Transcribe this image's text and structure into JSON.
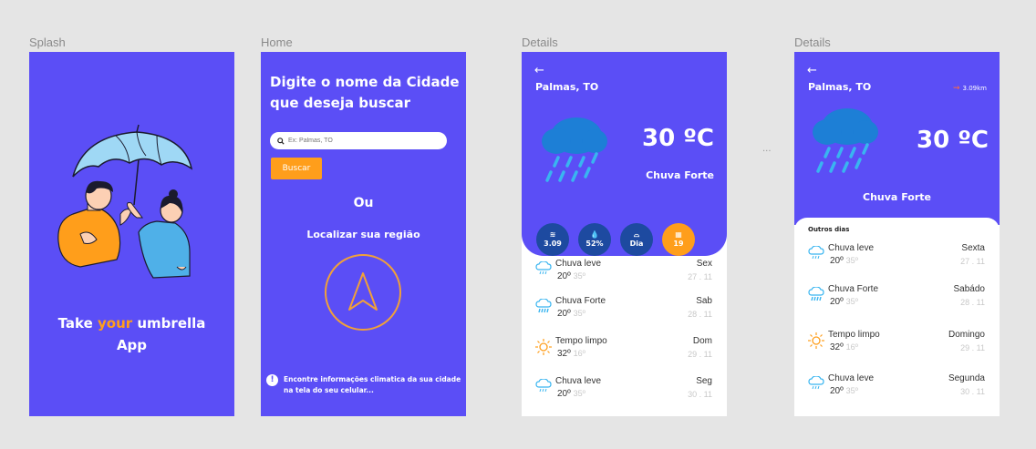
{
  "frames": {
    "splash": "Splash",
    "home": "Home",
    "details1": "Details",
    "details2": "Details"
  },
  "splash": {
    "title_pre": "Take ",
    "title_hl": "your",
    "title_mid": " umbrella",
    "title_line2": "App"
  },
  "home": {
    "heading": "Digite o nome da Cidade que deseja buscar",
    "search_placeholder": "Ex: Palmas, TO",
    "search_button": "Buscar",
    "or": "Ou",
    "locate_label": "Localizar sua região",
    "info": "Encontre informações climatica da sua cidade na tela do seu celular..."
  },
  "details1": {
    "city": "Palmas, TO",
    "temp": "30 ºC",
    "condition": "Chuva Forte",
    "pills": [
      {
        "icon": "wind-icon",
        "label": "3.09"
      },
      {
        "icon": "humidity-icon",
        "label": "52%"
      },
      {
        "icon": "sunrise-icon",
        "label": "Dia"
      },
      {
        "icon": "calendar-icon",
        "label": "19"
      }
    ],
    "forecast": [
      {
        "cond": "Chuva leve",
        "min": "20º",
        "max": "35º",
        "day": "Sex",
        "date": "27 . 11",
        "icon": "light-rain-icon"
      },
      {
        "cond": "Chuva Forte",
        "min": "20º",
        "max": "35º",
        "day": "Sab",
        "date": "28 . 11",
        "icon": "heavy-rain-icon"
      },
      {
        "cond": "Tempo limpo",
        "min": "32º",
        "max": "16º",
        "day": "Dom",
        "date": "29 . 11",
        "icon": "sun-icon"
      },
      {
        "cond": "Chuva leve",
        "min": "20º",
        "max": "35º",
        "day": "Seg",
        "date": "30 . 11",
        "icon": "light-rain-icon"
      }
    ]
  },
  "details2": {
    "city": "Palmas, TO",
    "distance": "3.09km",
    "temp": "30 ºC",
    "condition": "Chuva Forte",
    "other_days": "Outros dias",
    "forecast": [
      {
        "cond": "Chuva leve",
        "min": "20º",
        "max": "35º",
        "day": "Sexta",
        "date": "27 . 11",
        "icon": "light-rain-icon"
      },
      {
        "cond": "Chuva Forte",
        "min": "20º",
        "max": "35º",
        "day": "Sabádo",
        "date": "28 . 11",
        "icon": "heavy-rain-icon"
      },
      {
        "cond": "Tempo limpo",
        "min": "32º",
        "max": "16º",
        "day": "Domingo",
        "date": "29 . 11",
        "icon": "sun-icon"
      },
      {
        "cond": "Chuva leve",
        "min": "20º",
        "max": "35º",
        "day": "Segunda",
        "date": "30 . 11",
        "icon": "light-rain-icon"
      }
    ]
  },
  "colors": {
    "primary": "#5b4ef6",
    "accent": "#ff9e1b",
    "cloud": "#1d7fd6",
    "rain": "#39b5f0"
  },
  "separator": "..."
}
